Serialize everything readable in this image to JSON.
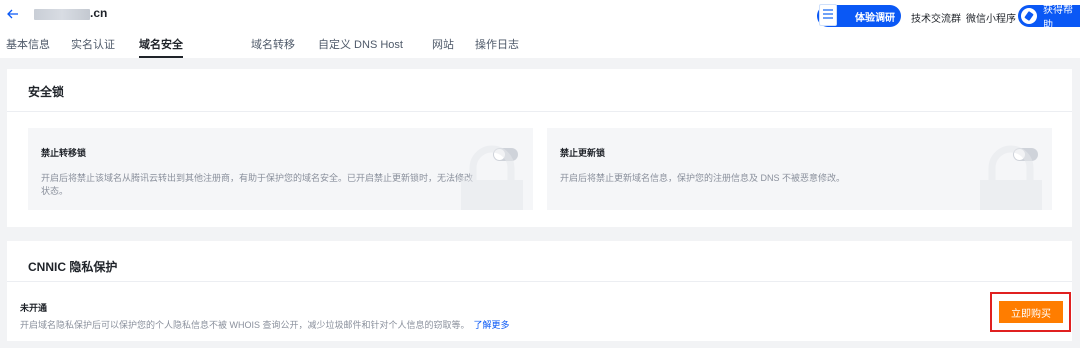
{
  "header": {
    "domain_suffix": ".cn",
    "survey_label": "体验调研",
    "links": [
      "技术交流群",
      "微信小程序"
    ],
    "help_label": "获得帮助",
    "brand_color": "#0a58f5"
  },
  "tabs": [
    {
      "label": "基本信息",
      "active": false
    },
    {
      "label": "实名认证",
      "active": false
    },
    {
      "label": "域名安全",
      "active": true
    },
    {
      "label": "域名转移",
      "active": false
    },
    {
      "label": "自定义 DNS Host",
      "active": false
    },
    {
      "label": "网站",
      "active": false
    },
    {
      "label": "操作日志",
      "active": false
    }
  ],
  "security_lock": {
    "title": "安全锁",
    "panels": [
      {
        "title": "禁止转移锁",
        "desc_line1": "开启后将禁止该域名从腾讯云转出到其他注册商，有助于保护您的域名安全。已开启禁止更新锁时，无法修改",
        "desc_line2": "状态。",
        "enabled": false
      },
      {
        "title": "禁止更新锁",
        "desc_line1": "开启后将禁止更新域名信息，保护您的注册信息及 DNS 不被恶意修改。",
        "desc_line2": "",
        "enabled": false
      }
    ]
  },
  "privacy": {
    "title": "CNNIC 隐私保护",
    "status": "未开通",
    "desc": "开启域名隐私保护后可以保护您的个人隐私信息不被 WHOIS 查询公开，减少垃圾邮件和针对个人信息的窃取等。",
    "learn_more": "了解更多",
    "buy_label": "立即购买",
    "buy_color": "#ff7d00",
    "highlight_color": "#e02020"
  }
}
